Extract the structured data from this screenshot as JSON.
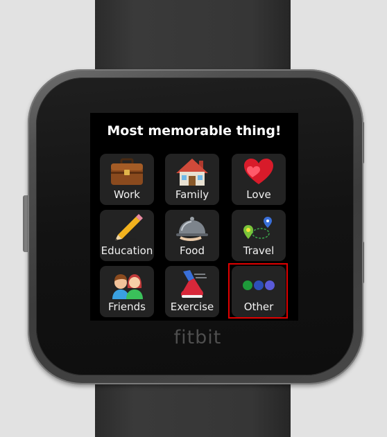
{
  "screen": {
    "title": "Most memorable thing!"
  },
  "watch": {
    "brand": "fitbit"
  },
  "options": [
    {
      "label": "Work",
      "icon": "briefcase-icon"
    },
    {
      "label": "Family",
      "icon": "house-icon"
    },
    {
      "label": "Love",
      "icon": "hearts-icon"
    },
    {
      "label": "Education",
      "icon": "pencil-icon"
    },
    {
      "label": "Food",
      "icon": "cloche-icon"
    },
    {
      "label": "Travel",
      "icon": "map-pins-icon"
    },
    {
      "label": "Friends",
      "icon": "friends-icon"
    },
    {
      "label": "Exercise",
      "icon": "running-shoe-icon"
    },
    {
      "label": "Other",
      "icon": "three-dots-icon"
    }
  ],
  "selection": {
    "selected": "Other",
    "highlight_color": "#e00000"
  },
  "colors": {
    "screen_bg": "#000000",
    "tile_bg": "#232323",
    "label_text": "#f2f2f2",
    "dot_green": "#1e9a3a",
    "dot_blue": "#2d4fb8",
    "dot_violet": "#5a5ad8"
  }
}
